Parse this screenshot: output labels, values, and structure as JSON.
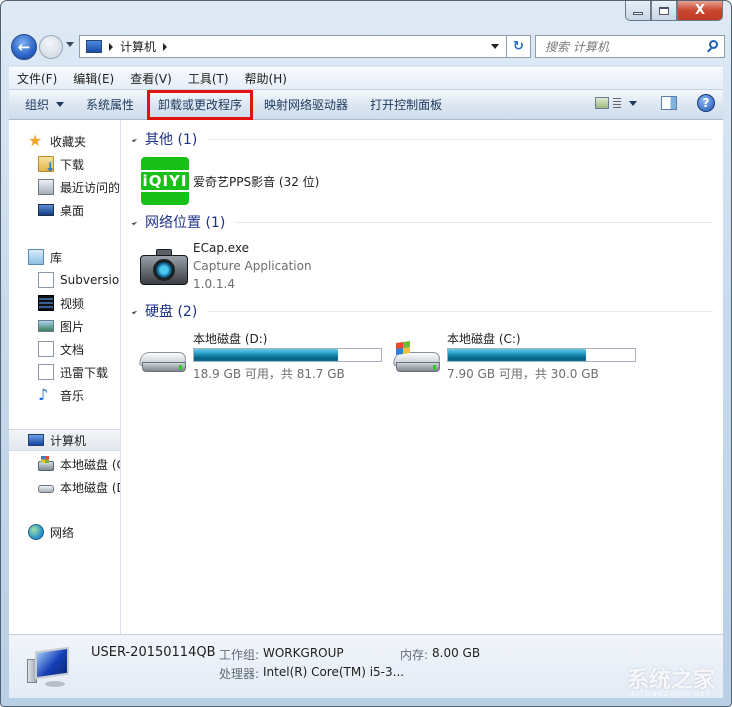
{
  "window": {
    "controls": {
      "minimize": "minimize",
      "maximize": "maximize",
      "close": "X"
    }
  },
  "navigation": {
    "back_icon": "←",
    "forward_icon": "→",
    "address": {
      "breadcrumb": [
        "计算机"
      ]
    },
    "refresh_icon": "↻",
    "search": {
      "placeholder": "搜索 计算机",
      "value": ""
    }
  },
  "menubar": {
    "items": [
      "文件(F)",
      "编辑(E)",
      "查看(V)",
      "工具(T)",
      "帮助(H)"
    ]
  },
  "command_bar": {
    "organize": "组织",
    "system_properties": "系统属性",
    "uninstall": "卸载或更改程序",
    "map_network_drive": "映射网络驱动器",
    "open_control_panel": "打开控制面板",
    "help_icon": "?"
  },
  "nav_pane": {
    "favorites": {
      "label": "收藏夹",
      "items": [
        "下载",
        "最近访问的位置",
        "桌面"
      ]
    },
    "libraries": {
      "label": "库",
      "items": [
        "Subversion",
        "视频",
        "图片",
        "文档",
        "迅雷下载",
        "音乐"
      ]
    },
    "computer": {
      "label": "计算机",
      "items": [
        "本地磁盘 (C:)",
        "本地磁盘 (D:)"
      ]
    },
    "network": {
      "label": "网络"
    }
  },
  "content": {
    "groups": [
      {
        "header": "其他 (1)",
        "items": [
          {
            "title": "爱奇艺PPS影音 (32 位)",
            "icon": "iqiyi-icon",
            "icon_text": "iQIYI"
          }
        ]
      },
      {
        "header": "网络位置 (1)",
        "items": [
          {
            "title": "ECap.exe",
            "description": "Capture Application",
            "version": "1.0.1.4",
            "icon": "camera-icon"
          }
        ]
      },
      {
        "header": "硬盘 (2)",
        "items": [
          {
            "title": "本地磁盘 (D:)",
            "usage": "18.9 GB 可用，共 81.7 GB",
            "free_gb": 18.9,
            "total_gb": 81.7,
            "used_fraction": 0.769
          },
          {
            "title": "本地磁盘 (C:)",
            "usage": "7.90 GB 可用，共 30.0 GB",
            "free_gb": 7.9,
            "total_gb": 30.0,
            "used_fraction": 0.737
          }
        ]
      }
    ]
  },
  "details_pane": {
    "computer_name": "USER-20150114QB",
    "workgroup_label": "工作组:",
    "workgroup_value": "WORKGROUP",
    "memory_label": "内存:",
    "memory_value": "8.00 GB",
    "processor_label": "处理器:",
    "processor_value": "Intel(R) Core(TM) i5-3..."
  },
  "watermark": {
    "text": "系统之家",
    "sub": "XITONGZHIJIA.NET"
  }
}
